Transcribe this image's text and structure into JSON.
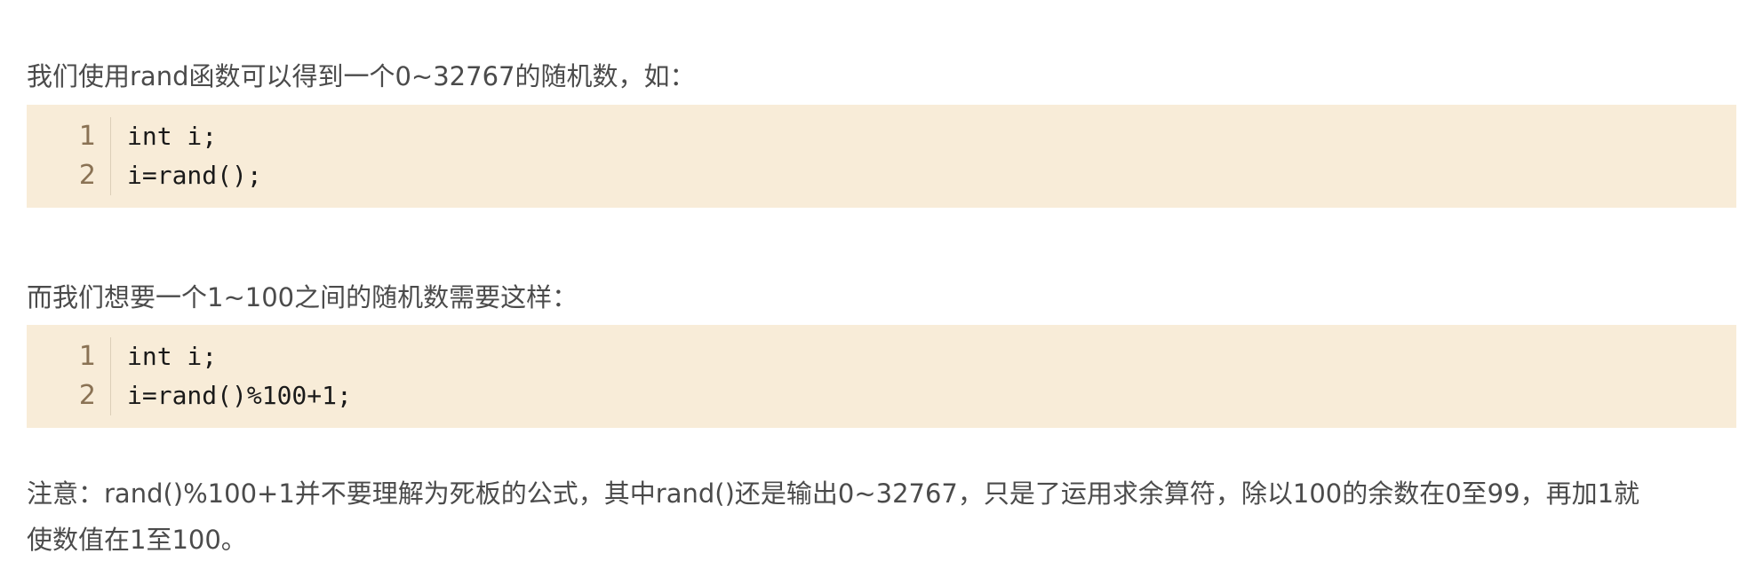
{
  "paragraphs": {
    "intro": "我们使用rand函数可以得到一个0~32767的随机数，如：",
    "range": "而我们想要一个1~100之间的随机数需要这样：",
    "note_line1": "注意：rand()%100+1并不要理解为死板的公式，其中rand()还是输出0~32767，只是了运用求余算符，除以100的余数在0至99，再加1就",
    "note_line2": "使数值在1至100。"
  },
  "code_blocks": [
    {
      "line_numbers": [
        "1",
        "2"
      ],
      "lines": [
        "int i;",
        "i=rand();"
      ]
    },
    {
      "line_numbers": [
        "1",
        "2"
      ],
      "lines": [
        "int i;",
        "i=rand()%100+1;"
      ]
    }
  ],
  "colors": {
    "code_background": "#f8ecd8",
    "line_number": "#8a7254",
    "body_text": "#4b4b4b",
    "code_text": "#1a1a1a"
  }
}
